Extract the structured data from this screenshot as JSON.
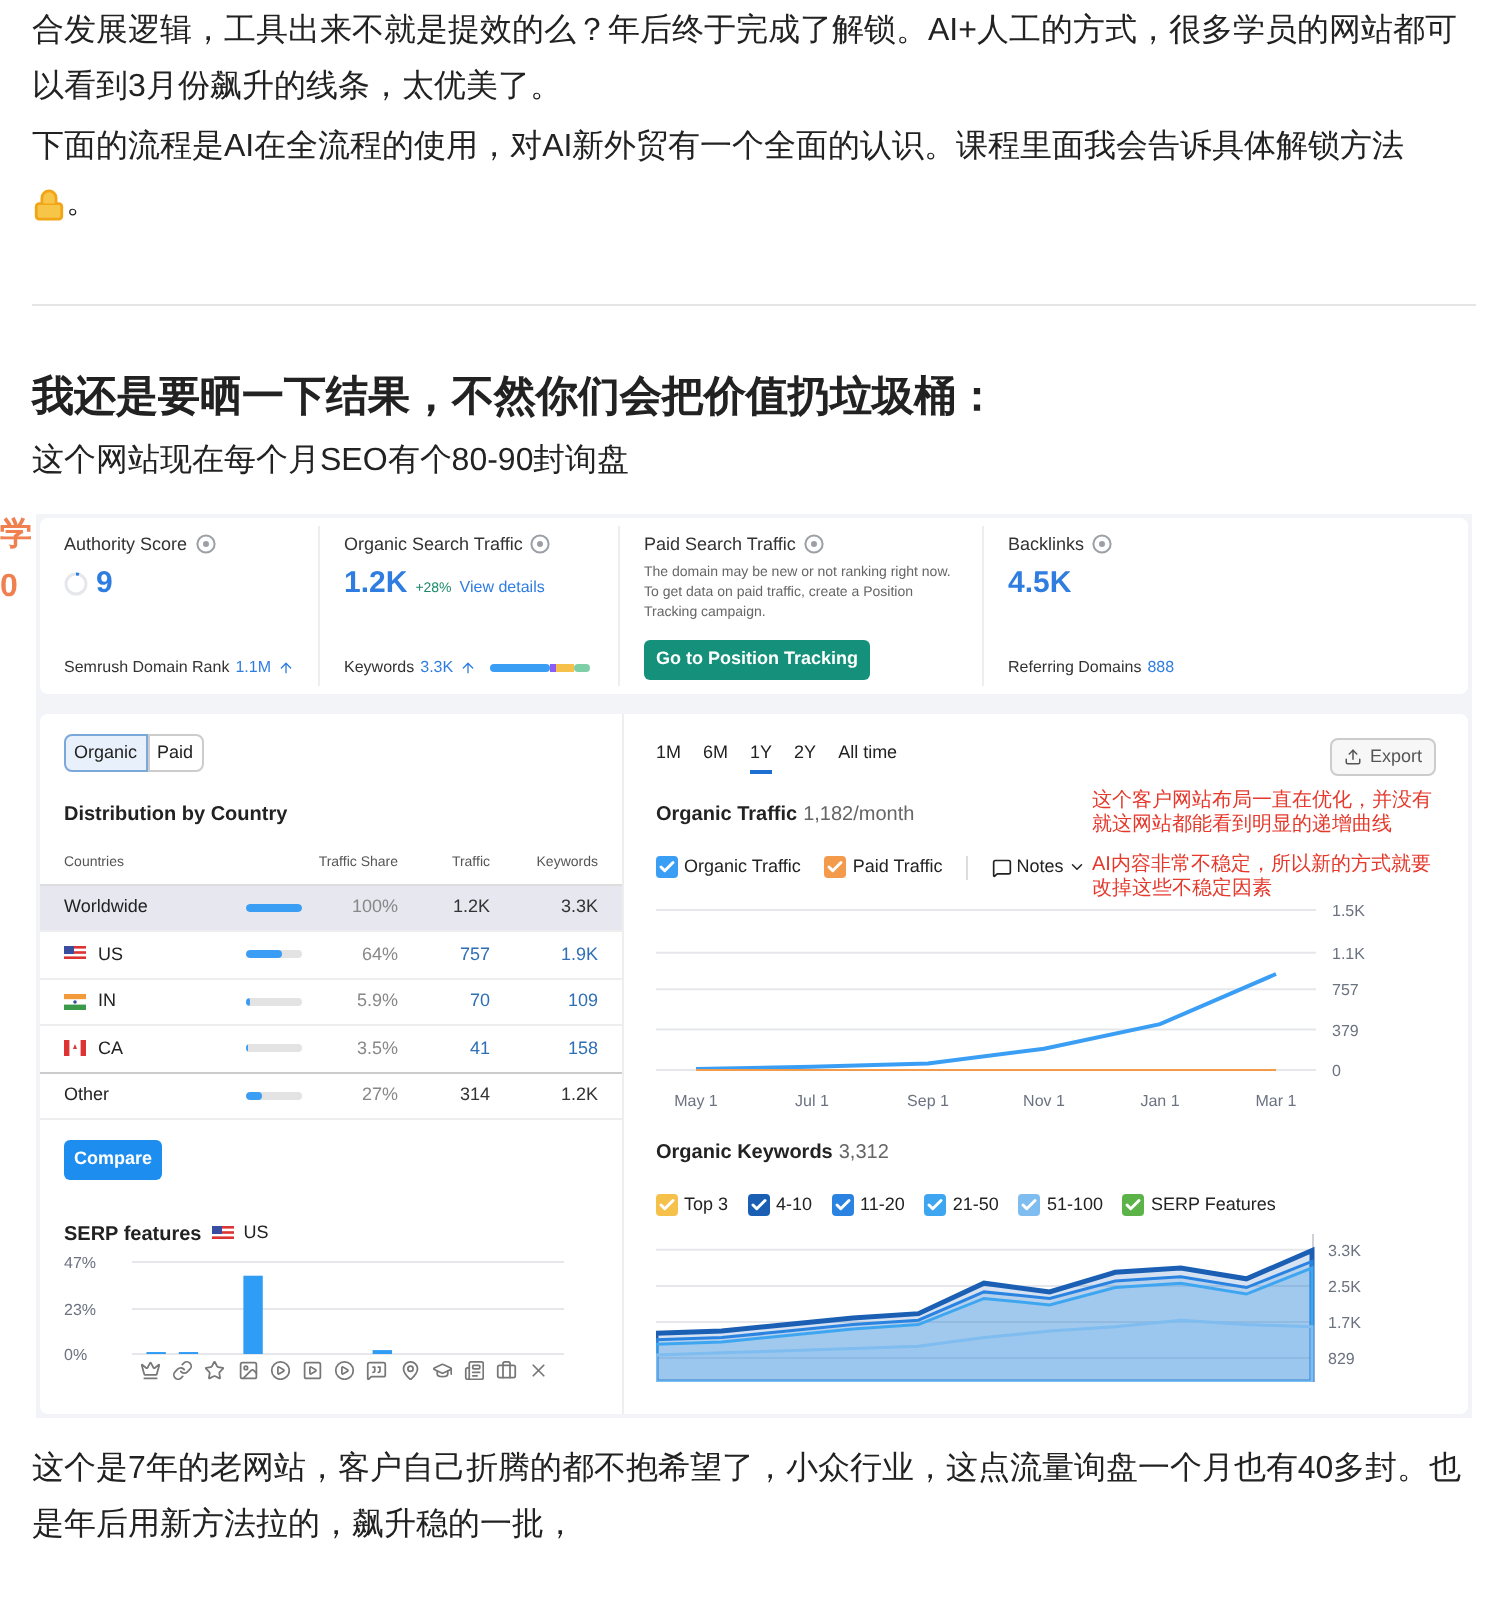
{
  "intro_paragraphs": [
    "合发展逻辑，工具出来不就是提效的么？年后终于完成了解锁。AI+人工的方式，很多学员的网站都可以看到3月份飙升的线条，太优美了。",
    "下面的流程是AI在全流程的使用，对AI新外贸有一个全面的认识。课程里面我会告诉具体解锁方法"
  ],
  "intro_tail": "。",
  "heading": "我还是要晒一下结果，不然你们会把价值扔垃圾桶：",
  "subheading": "这个网站现在每个月SEO有个80-90封询盘",
  "side_marks": [
    "学",
    "0"
  ],
  "overview": {
    "authority": {
      "label": "Authority Score",
      "value": "9",
      "rank_label": "Semrush Domain Rank",
      "rank_value": "1.1M"
    },
    "organic": {
      "label": "Organic Search Traffic",
      "value": "1.2K",
      "change": "+28%",
      "link": "View details",
      "keywords_label": "Keywords",
      "keywords_value": "3.3K"
    },
    "paid": {
      "label": "Paid Search Traffic",
      "note": "The domain may be new or not ranking right now. To get data on paid traffic, create a Position Tracking campaign.",
      "button": "Go to Position Tracking"
    },
    "backlinks": {
      "label": "Backlinks",
      "value": "4.5K",
      "ref_label": "Referring Domains",
      "ref_value": "888"
    }
  },
  "type_tabs": [
    {
      "label": "Organic",
      "selected": true
    },
    {
      "label": "Paid",
      "selected": false
    }
  ],
  "distribution": {
    "title": "Distribution by Country",
    "columns": [
      "Countries",
      "Traffic Share",
      "Traffic",
      "Keywords"
    ],
    "rows": [
      {
        "kind": "total",
        "name": "Worldwide",
        "level": 1.0,
        "share": "100%",
        "traffic": "1.2K",
        "keywords": "3.3K",
        "selected": true
      },
      {
        "kind": "country",
        "name": "US",
        "level": 0.64,
        "share": "64%",
        "traffic": "757",
        "keywords": "1.9K",
        "selected": false
      },
      {
        "kind": "country",
        "name": "IN",
        "level": 0.059,
        "share": "5.9%",
        "traffic": "70",
        "keywords": "109",
        "selected": false
      },
      {
        "kind": "country",
        "name": "CA",
        "level": 0.035,
        "share": "3.5%",
        "traffic": "41",
        "keywords": "158",
        "selected": false
      },
      {
        "kind": "other",
        "name": "Other",
        "level": 0.27,
        "share": "27%",
        "traffic": "314",
        "keywords": "1.2K",
        "selected": false
      }
    ],
    "button": "Compare"
  },
  "serp": {
    "title": "SERP features",
    "country": "US",
    "chart_data": {
      "type": "bar",
      "grid": true,
      "values": [
        1,
        1,
        0,
        40,
        0,
        0,
        0,
        2,
        0,
        0,
        0,
        0,
        0
      ],
      "ylim": [
        0,
        47
      ],
      "yticks": [
        {
          "value": 0,
          "label": "0%"
        },
        {
          "value": 23,
          "label": "23%"
        },
        {
          "value": 47,
          "label": "47%"
        }
      ]
    }
  },
  "periods": [
    {
      "label": "1M",
      "selected": false
    },
    {
      "label": "6M",
      "selected": false
    },
    {
      "label": "1Y",
      "selected": true
    },
    {
      "label": "2Y",
      "selected": false
    },
    {
      "label": "All time",
      "selected": false
    }
  ],
  "export_button": "Export",
  "traffic": {
    "title": "Organic Traffic",
    "value": "1,182/month",
    "legend_states": [
      {
        "checked": true
      },
      {
        "checked": true
      }
    ],
    "notes": "Notes",
    "chart_data": {
      "type": "line",
      "grid": true,
      "legend": "top",
      "x": [
        "May 1",
        "Jul 1",
        "Sep 1",
        "Nov 1",
        "Jan 1",
        "Mar 1"
      ],
      "ylim": [
        0,
        1500
      ],
      "yticks": [
        {
          "value": 0,
          "label": "0"
        },
        {
          "value": 379,
          "label": "379"
        },
        {
          "value": 757,
          "label": "757"
        },
        {
          "value": 1100,
          "label": "1.1K"
        },
        {
          "value": 1500,
          "label": "1.5K"
        }
      ],
      "series": [
        {
          "name": "Organic Traffic",
          "color": "#3b9ef5",
          "values": [
            10,
            30,
            60,
            200,
            430,
            900
          ]
        },
        {
          "name": "Paid Traffic",
          "color": "#f39a4b",
          "values": [
            0,
            0,
            0,
            0,
            0,
            0
          ]
        }
      ]
    }
  },
  "annotations": [
    "这个客户网站布局一直在优化，并没有",
    "就这网站都能看到明显的递增曲线",
    "AI内容非常不稳定，所以新的方式就要",
    "改掉这些不稳定因素"
  ],
  "keywords": {
    "title": "Organic Keywords",
    "value": "3,312",
    "legend_states": [
      {
        "checked": true
      },
      {
        "checked": true
      },
      {
        "checked": true
      },
      {
        "checked": true
      },
      {
        "checked": true
      },
      {
        "checked": true
      }
    ],
    "chart_data": {
      "type": "area",
      "grid": true,
      "legend": "top",
      "ylim": [
        280,
        3680
      ],
      "yticks": [
        {
          "value": 829,
          "label": "829"
        },
        {
          "value": 1658,
          "label": "1.7K"
        },
        {
          "value": 2487,
          "label": "2.5K"
        },
        {
          "value": 3316,
          "label": "3.3K"
        }
      ],
      "series": [
        {
          "name": "Top 3",
          "color": "#f6c14b",
          "values": [
            null,
            null,
            null,
            null,
            null,
            null,
            null,
            null,
            null,
            null,
            null
          ]
        },
        {
          "name": "4-10",
          "color": "#1a5fb4",
          "values": [
            1400,
            1450,
            1600,
            1750,
            1850,
            2550,
            2350,
            2800,
            2900,
            2650,
            3300
          ]
        },
        {
          "name": "11-20",
          "color": "#2a83e0",
          "values": [
            1250,
            1300,
            1450,
            1600,
            1700,
            2350,
            2200,
            2600,
            2700,
            2450,
            3050
          ]
        },
        {
          "name": "21-50",
          "color": "#3ea6f0",
          "values": [
            1150,
            1200,
            1350,
            1500,
            1600,
            2200,
            2050,
            2450,
            2550,
            2300,
            2900
          ]
        },
        {
          "name": "51-100",
          "color": "#7fbcf0",
          "values": [
            900,
            950,
            1000,
            1050,
            1100,
            1300,
            1450,
            1550,
            1700,
            1600,
            1550
          ]
        },
        {
          "name": "SERP Features",
          "color": "#5cb348",
          "values": [
            null,
            null,
            null,
            null,
            null,
            null,
            null,
            null,
            null,
            null,
            null
          ]
        }
      ]
    }
  },
  "outro": "这个是7年的老网站，客户自己折腾的都不抱希望了，小众行业，这点流量询盘一个月也有40多封。也是年后用新方法拉的，飙升稳的一批，"
}
